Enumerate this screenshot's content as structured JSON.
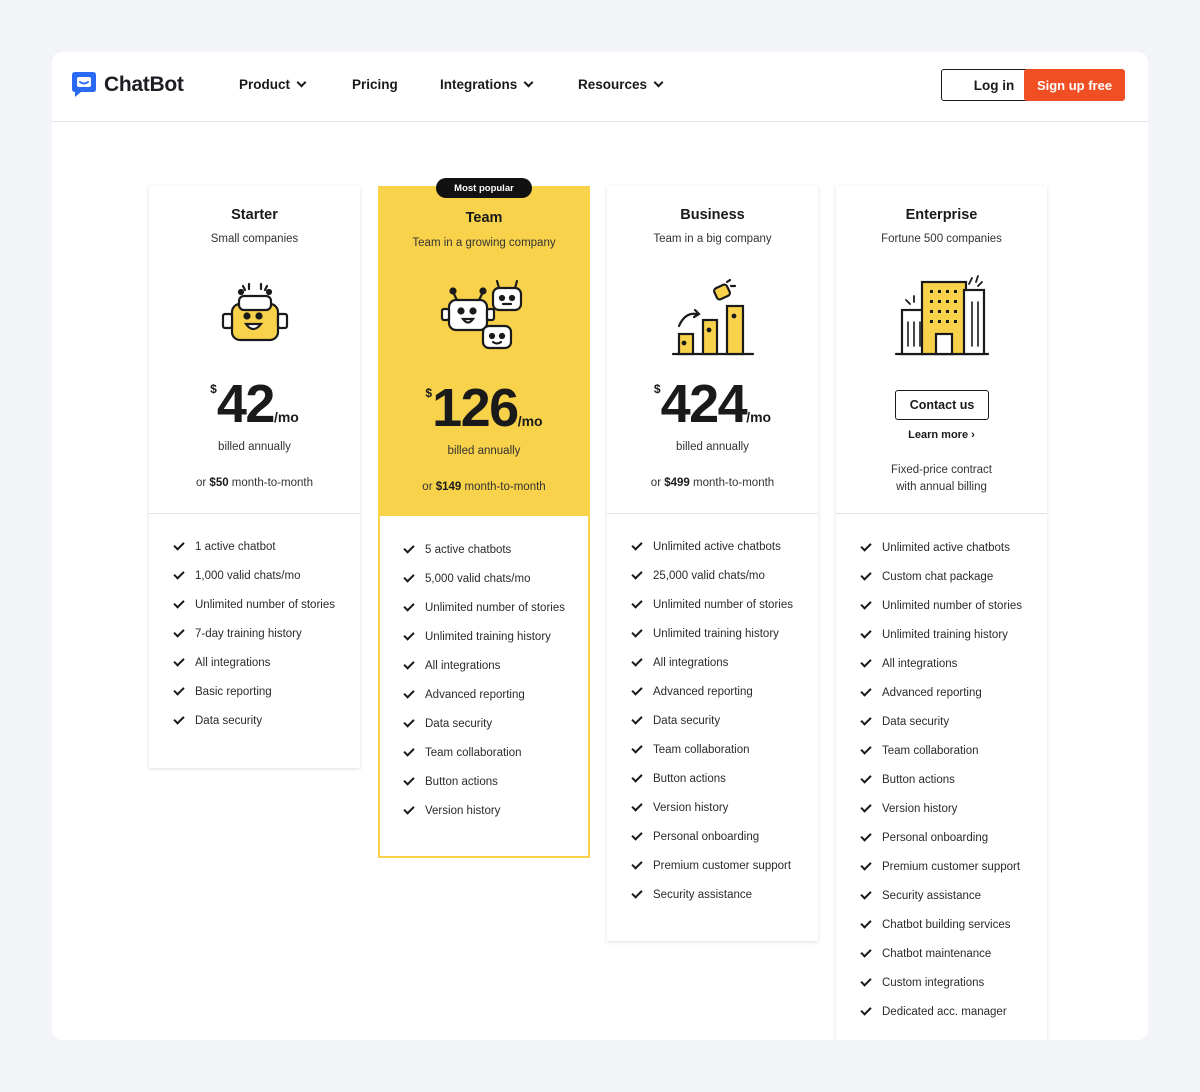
{
  "brand": {
    "name": "ChatBot",
    "accent": "#2b6bf3"
  },
  "nav": {
    "items": [
      {
        "label": "Product",
        "has_dropdown": true
      },
      {
        "label": "Pricing",
        "has_dropdown": false
      },
      {
        "label": "Integrations",
        "has_dropdown": true
      },
      {
        "label": "Resources",
        "has_dropdown": true
      }
    ],
    "login_label": "Log in",
    "signup_label": "Sign up free"
  },
  "colors": {
    "featured": "#f8d24a",
    "cta": "#f04e23"
  },
  "plans": [
    {
      "name": "Starter",
      "subtitle": "Small companies",
      "currency": "$",
      "price": "42",
      "period": "/mo",
      "billed": "billed annually",
      "mtm_prefix": "or ",
      "mtm_price": "$50",
      "mtm_suffix": " month-to-month",
      "features": [
        "1 active chatbot",
        "1,000 valid chats/mo",
        "Unlimited number of stories",
        "7-day training history",
        "All integrations",
        "Basic reporting",
        "Data security"
      ]
    },
    {
      "name": "Team",
      "subtitle": "Team in a growing company",
      "badge": "Most popular",
      "currency": "$",
      "price": "126",
      "period": "/mo",
      "billed": "billed annually",
      "mtm_prefix": "or ",
      "mtm_price": "$149",
      "mtm_suffix": " month-to-month",
      "features": [
        "5 active chatbots",
        "5,000 valid chats/mo",
        "Unlimited number of stories",
        "Unlimited training history",
        "All integrations",
        "Advanced reporting",
        "Data security",
        "Team collaboration",
        "Button actions",
        "Version history"
      ]
    },
    {
      "name": "Business",
      "subtitle": "Team in a big company",
      "currency": "$",
      "price": "424",
      "period": "/mo",
      "billed": "billed annually",
      "mtm_prefix": "or ",
      "mtm_price": "$499",
      "mtm_suffix": " month-to-month",
      "features": [
        "Unlimited active chatbots",
        "25,000 valid chats/mo",
        "Unlimited number of stories",
        "Unlimited training history",
        "All integrations",
        "Advanced reporting",
        "Data security",
        "Team collaboration",
        "Button actions",
        "Version history",
        "Personal onboarding",
        "Premium customer support",
        "Security assistance"
      ]
    },
    {
      "name": "Enterprise",
      "subtitle": "Fortune 500 companies",
      "contact_label": "Contact us",
      "learn_more": "Learn more ›",
      "fixed_line1": "Fixed-price contract",
      "fixed_line2": "with annual billing",
      "features": [
        "Unlimited active chatbots",
        "Custom chat package",
        "Unlimited number of stories",
        "Unlimited training history",
        "All integrations",
        "Advanced reporting",
        "Data security",
        "Team collaboration",
        "Button actions",
        "Version history",
        "Personal onboarding",
        "Premium customer support",
        "Security assistance",
        "Chatbot building services",
        "Chatbot maintenance",
        "Custom integrations",
        "Dedicated acc. manager"
      ]
    }
  ]
}
